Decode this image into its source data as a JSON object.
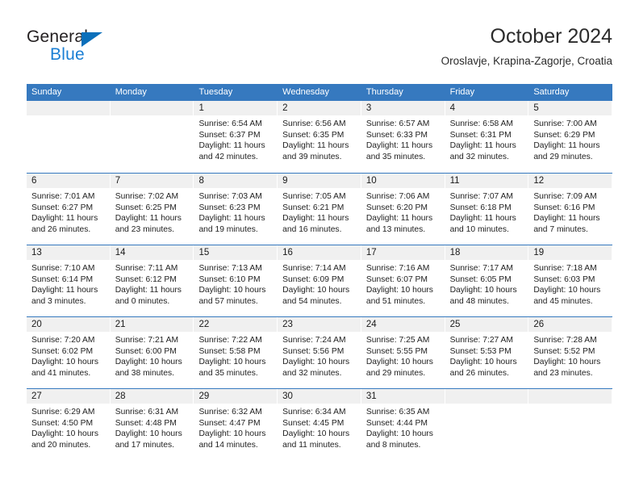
{
  "brand": {
    "name_primary": "General",
    "name_secondary": "Blue",
    "accent_color": "#1b7fd4",
    "triangle_color": "#0b6fba"
  },
  "header": {
    "title": "October 2024",
    "subtitle": "Oroslavje, Krapina-Zagorje, Croatia",
    "header_bg_color": "#3679bf",
    "day_band_color": "#f0f0f0"
  },
  "weekdays": [
    "Sunday",
    "Monday",
    "Tuesday",
    "Wednesday",
    "Thursday",
    "Friday",
    "Saturday"
  ],
  "weeks": [
    [
      {
        "date": "",
        "empty": true
      },
      {
        "date": "",
        "empty": true
      },
      {
        "date": "1",
        "sunrise": "Sunrise: 6:54 AM",
        "sunset": "Sunset: 6:37 PM",
        "daylight_1": "Daylight: 11 hours",
        "daylight_2": "and 42 minutes."
      },
      {
        "date": "2",
        "sunrise": "Sunrise: 6:56 AM",
        "sunset": "Sunset: 6:35 PM",
        "daylight_1": "Daylight: 11 hours",
        "daylight_2": "and 39 minutes."
      },
      {
        "date": "3",
        "sunrise": "Sunrise: 6:57 AM",
        "sunset": "Sunset: 6:33 PM",
        "daylight_1": "Daylight: 11 hours",
        "daylight_2": "and 35 minutes."
      },
      {
        "date": "4",
        "sunrise": "Sunrise: 6:58 AM",
        "sunset": "Sunset: 6:31 PM",
        "daylight_1": "Daylight: 11 hours",
        "daylight_2": "and 32 minutes."
      },
      {
        "date": "5",
        "sunrise": "Sunrise: 7:00 AM",
        "sunset": "Sunset: 6:29 PM",
        "daylight_1": "Daylight: 11 hours",
        "daylight_2": "and 29 minutes."
      }
    ],
    [
      {
        "date": "6",
        "sunrise": "Sunrise: 7:01 AM",
        "sunset": "Sunset: 6:27 PM",
        "daylight_1": "Daylight: 11 hours",
        "daylight_2": "and 26 minutes."
      },
      {
        "date": "7",
        "sunrise": "Sunrise: 7:02 AM",
        "sunset": "Sunset: 6:25 PM",
        "daylight_1": "Daylight: 11 hours",
        "daylight_2": "and 23 minutes."
      },
      {
        "date": "8",
        "sunrise": "Sunrise: 7:03 AM",
        "sunset": "Sunset: 6:23 PM",
        "daylight_1": "Daylight: 11 hours",
        "daylight_2": "and 19 minutes."
      },
      {
        "date": "9",
        "sunrise": "Sunrise: 7:05 AM",
        "sunset": "Sunset: 6:21 PM",
        "daylight_1": "Daylight: 11 hours",
        "daylight_2": "and 16 minutes."
      },
      {
        "date": "10",
        "sunrise": "Sunrise: 7:06 AM",
        "sunset": "Sunset: 6:20 PM",
        "daylight_1": "Daylight: 11 hours",
        "daylight_2": "and 13 minutes."
      },
      {
        "date": "11",
        "sunrise": "Sunrise: 7:07 AM",
        "sunset": "Sunset: 6:18 PM",
        "daylight_1": "Daylight: 11 hours",
        "daylight_2": "and 10 minutes."
      },
      {
        "date": "12",
        "sunrise": "Sunrise: 7:09 AM",
        "sunset": "Sunset: 6:16 PM",
        "daylight_1": "Daylight: 11 hours",
        "daylight_2": "and 7 minutes."
      }
    ],
    [
      {
        "date": "13",
        "sunrise": "Sunrise: 7:10 AM",
        "sunset": "Sunset: 6:14 PM",
        "daylight_1": "Daylight: 11 hours",
        "daylight_2": "and 3 minutes."
      },
      {
        "date": "14",
        "sunrise": "Sunrise: 7:11 AM",
        "sunset": "Sunset: 6:12 PM",
        "daylight_1": "Daylight: 11 hours",
        "daylight_2": "and 0 minutes."
      },
      {
        "date": "15",
        "sunrise": "Sunrise: 7:13 AM",
        "sunset": "Sunset: 6:10 PM",
        "daylight_1": "Daylight: 10 hours",
        "daylight_2": "and 57 minutes."
      },
      {
        "date": "16",
        "sunrise": "Sunrise: 7:14 AM",
        "sunset": "Sunset: 6:09 PM",
        "daylight_1": "Daylight: 10 hours",
        "daylight_2": "and 54 minutes."
      },
      {
        "date": "17",
        "sunrise": "Sunrise: 7:16 AM",
        "sunset": "Sunset: 6:07 PM",
        "daylight_1": "Daylight: 10 hours",
        "daylight_2": "and 51 minutes."
      },
      {
        "date": "18",
        "sunrise": "Sunrise: 7:17 AM",
        "sunset": "Sunset: 6:05 PM",
        "daylight_1": "Daylight: 10 hours",
        "daylight_2": "and 48 minutes."
      },
      {
        "date": "19",
        "sunrise": "Sunrise: 7:18 AM",
        "sunset": "Sunset: 6:03 PM",
        "daylight_1": "Daylight: 10 hours",
        "daylight_2": "and 45 minutes."
      }
    ],
    [
      {
        "date": "20",
        "sunrise": "Sunrise: 7:20 AM",
        "sunset": "Sunset: 6:02 PM",
        "daylight_1": "Daylight: 10 hours",
        "daylight_2": "and 41 minutes."
      },
      {
        "date": "21",
        "sunrise": "Sunrise: 7:21 AM",
        "sunset": "Sunset: 6:00 PM",
        "daylight_1": "Daylight: 10 hours",
        "daylight_2": "and 38 minutes."
      },
      {
        "date": "22",
        "sunrise": "Sunrise: 7:22 AM",
        "sunset": "Sunset: 5:58 PM",
        "daylight_1": "Daylight: 10 hours",
        "daylight_2": "and 35 minutes."
      },
      {
        "date": "23",
        "sunrise": "Sunrise: 7:24 AM",
        "sunset": "Sunset: 5:56 PM",
        "daylight_1": "Daylight: 10 hours",
        "daylight_2": "and 32 minutes."
      },
      {
        "date": "24",
        "sunrise": "Sunrise: 7:25 AM",
        "sunset": "Sunset: 5:55 PM",
        "daylight_1": "Daylight: 10 hours",
        "daylight_2": "and 29 minutes."
      },
      {
        "date": "25",
        "sunrise": "Sunrise: 7:27 AM",
        "sunset": "Sunset: 5:53 PM",
        "daylight_1": "Daylight: 10 hours",
        "daylight_2": "and 26 minutes."
      },
      {
        "date": "26",
        "sunrise": "Sunrise: 7:28 AM",
        "sunset": "Sunset: 5:52 PM",
        "daylight_1": "Daylight: 10 hours",
        "daylight_2": "and 23 minutes."
      }
    ],
    [
      {
        "date": "27",
        "sunrise": "Sunrise: 6:29 AM",
        "sunset": "Sunset: 4:50 PM",
        "daylight_1": "Daylight: 10 hours",
        "daylight_2": "and 20 minutes."
      },
      {
        "date": "28",
        "sunrise": "Sunrise: 6:31 AM",
        "sunset": "Sunset: 4:48 PM",
        "daylight_1": "Daylight: 10 hours",
        "daylight_2": "and 17 minutes."
      },
      {
        "date": "29",
        "sunrise": "Sunrise: 6:32 AM",
        "sunset": "Sunset: 4:47 PM",
        "daylight_1": "Daylight: 10 hours",
        "daylight_2": "and 14 minutes."
      },
      {
        "date": "30",
        "sunrise": "Sunrise: 6:34 AM",
        "sunset": "Sunset: 4:45 PM",
        "daylight_1": "Daylight: 10 hours",
        "daylight_2": "and 11 minutes."
      },
      {
        "date": "31",
        "sunrise": "Sunrise: 6:35 AM",
        "sunset": "Sunset: 4:44 PM",
        "daylight_1": "Daylight: 10 hours",
        "daylight_2": "and 8 minutes."
      },
      {
        "date": "",
        "empty": true
      },
      {
        "date": "",
        "empty": true
      }
    ]
  ]
}
